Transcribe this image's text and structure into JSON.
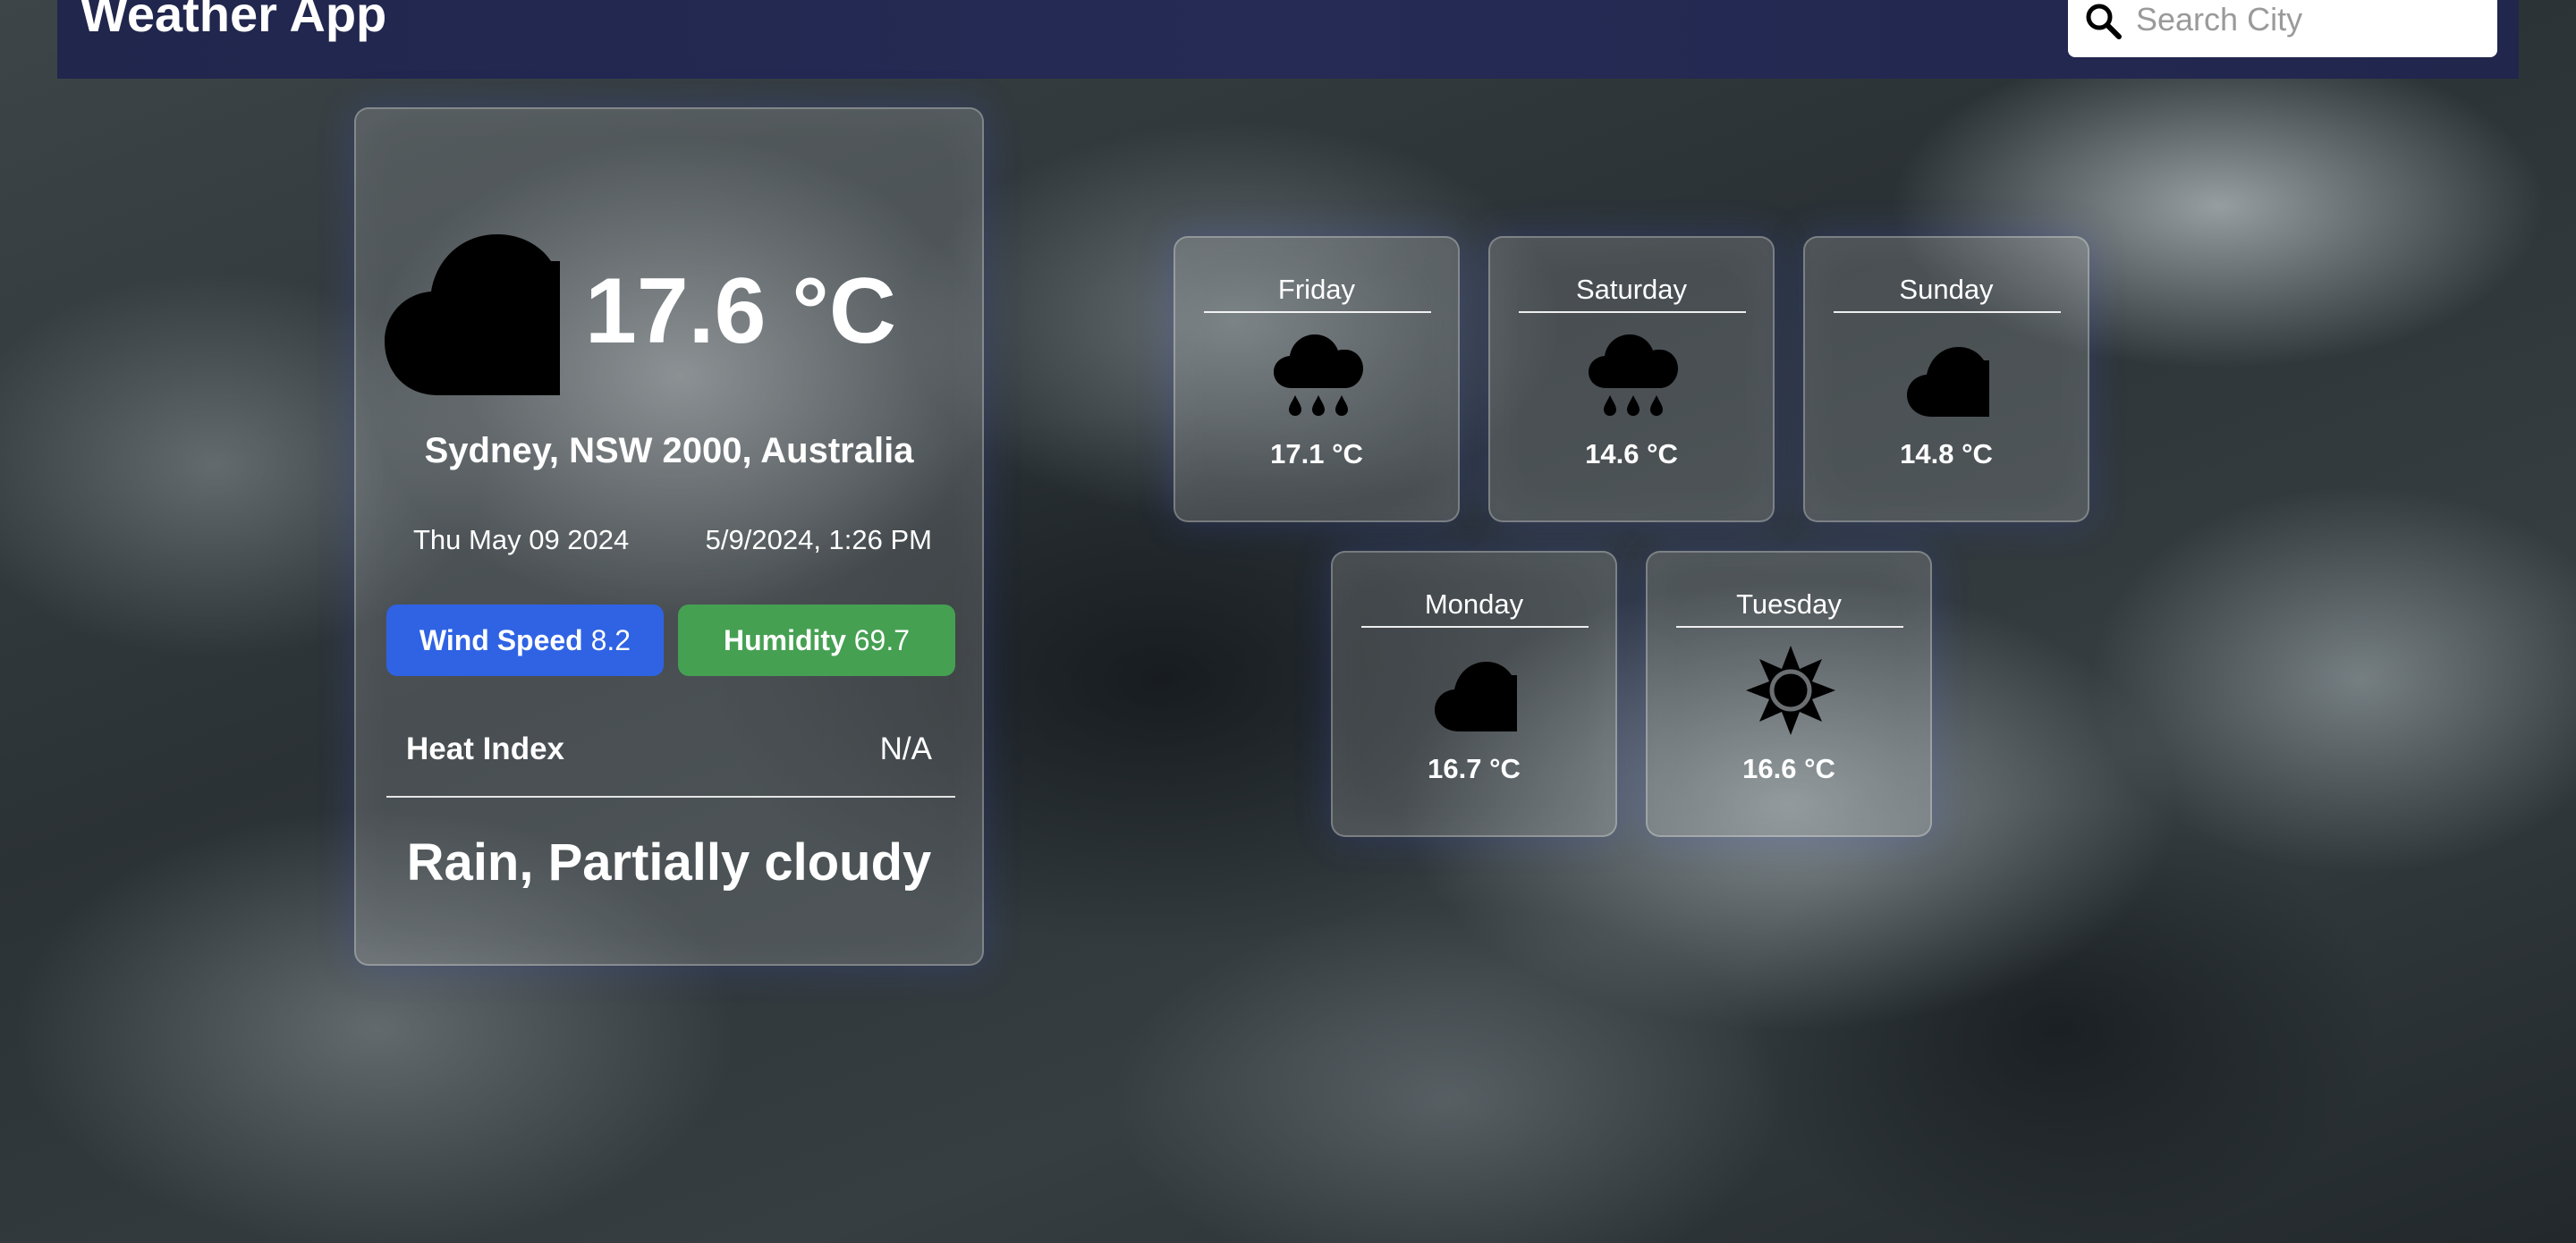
{
  "header": {
    "title": "Weather App",
    "search_placeholder": "Search City",
    "search_value": "",
    "background_color": "#20264c"
  },
  "current": {
    "icon": "cloud-icon",
    "temperature": "17.6 °C",
    "location": "Sydney, NSW 2000, Australia",
    "date": "Thu May 09 2024",
    "datetime": "5/9/2024, 1:26 PM",
    "wind": {
      "label": "Wind Speed",
      "value": "8.2",
      "color": "#2f63e4"
    },
    "humidity": {
      "label": "Humidity",
      "value": "69.7",
      "color": "#45a052"
    },
    "heat_index": {
      "label": "Heat Index",
      "value": "N/A"
    },
    "conditions": "Rain, Partially cloudy"
  },
  "forecast": [
    {
      "day": "Friday",
      "icon": "rain-cloud-icon",
      "temperature": "17.1 °C"
    },
    {
      "day": "Saturday",
      "icon": "rain-cloud-icon",
      "temperature": "14.6 °C"
    },
    {
      "day": "Sunday",
      "icon": "cloud-icon",
      "temperature": "14.8 °C"
    },
    {
      "day": "Monday",
      "icon": "cloud-icon",
      "temperature": "16.7 °C"
    },
    {
      "day": "Tuesday",
      "icon": "sun-icon",
      "temperature": "16.6 °C"
    }
  ]
}
